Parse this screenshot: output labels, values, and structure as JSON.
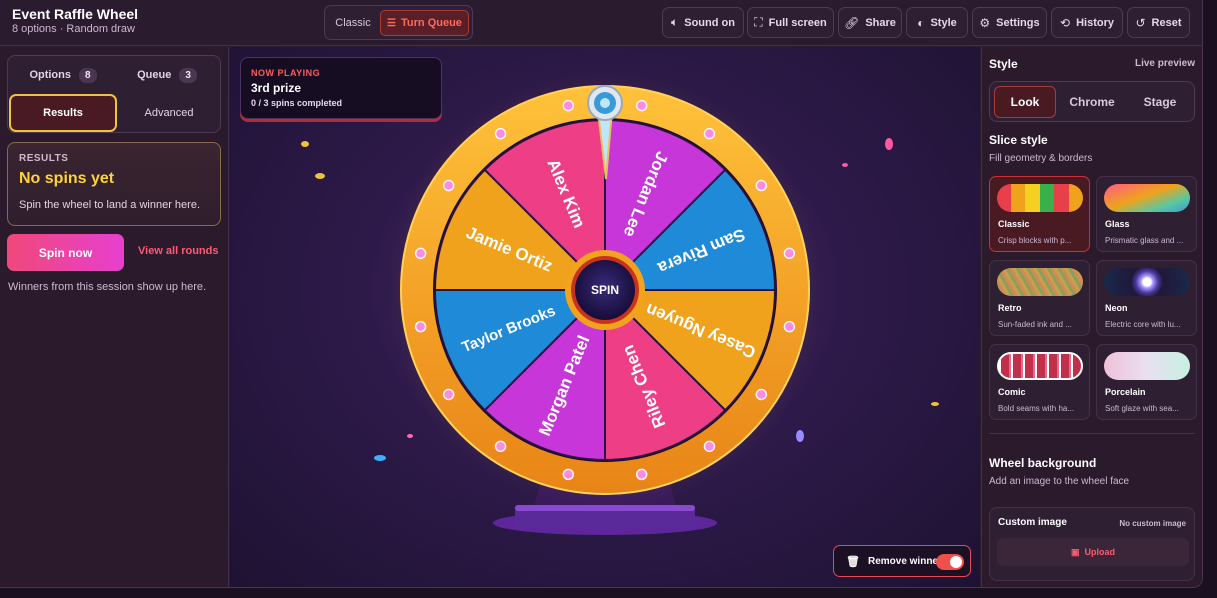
{
  "app": {
    "title": "Event Raffle Wheel",
    "subtitle": "8 options  ·  Random draw"
  },
  "modes": {
    "classic": "Classic",
    "queue": "Turn Queue",
    "active": "queue"
  },
  "toolbar": {
    "sound": "Sound on",
    "fullscreen": "Full screen",
    "share": "Share",
    "style": "Style",
    "settings": "Settings",
    "history": "History",
    "reset": "Reset"
  },
  "left": {
    "tabs": {
      "options": "Options",
      "options_count": "8",
      "queue": "Queue",
      "queue_count": "3",
      "results": "Results",
      "advanced": "Advanced"
    },
    "results": {
      "kicker": "RESULTS",
      "title": "No spins yet",
      "desc": "Spin the wheel to land a winner here."
    },
    "spin_now": "Spin now",
    "view_all": "View all rounds",
    "session_note": "Winners from this session show up here."
  },
  "now_playing": {
    "kicker": "NOW PLAYING",
    "title": "3rd prize",
    "status": "0 / 3 spins completed"
  },
  "wheel": {
    "center_label": "SPIN",
    "slices": [
      {
        "name": "Jordan Lee",
        "color": "#c736d8"
      },
      {
        "name": "Sam Rivera",
        "color": "#1f8ad8"
      },
      {
        "name": "Casey Nguyen",
        "color": "#f0a21c"
      },
      {
        "name": "Riley Chen",
        "color": "#ee3f86"
      },
      {
        "name": "Morgan Patel",
        "color": "#c736d8"
      },
      {
        "name": "Taylor Brooks",
        "color": "#1f8ad8"
      },
      {
        "name": "Jamie Ortiz",
        "color": "#f0a21c"
      },
      {
        "name": "Alex Kim",
        "color": "#ee3f86"
      }
    ],
    "rim_color": "#f2a31e"
  },
  "remove_winner": {
    "label": "Remove winner",
    "enabled": true
  },
  "right": {
    "title": "Style",
    "live": "Live preview",
    "tabs": {
      "look": "Look",
      "chrome": "Chrome",
      "stage": "Stage"
    },
    "slice_style": {
      "title": "Slice style",
      "desc": "Fill geometry & borders"
    },
    "cards": [
      {
        "name": "Classic",
        "desc": "Crisp blocks with p...",
        "selected": true
      },
      {
        "name": "Glass",
        "desc": "Prismatic glass and ...",
        "selected": false
      },
      {
        "name": "Retro",
        "desc": "Sun-faded ink and ...",
        "selected": false
      },
      {
        "name": "Neon",
        "desc": "Electric core with lu...",
        "selected": false
      },
      {
        "name": "Comic",
        "desc": "Bold seams with ha...",
        "selected": false
      },
      {
        "name": "Porcelain",
        "desc": "Soft glaze with sea...",
        "selected": false
      }
    ],
    "background": {
      "title": "Wheel background",
      "desc": "Add an image to the wheel face"
    },
    "custom_image": {
      "title": "Custom image",
      "status": "No custom image",
      "upload": "Upload"
    }
  }
}
